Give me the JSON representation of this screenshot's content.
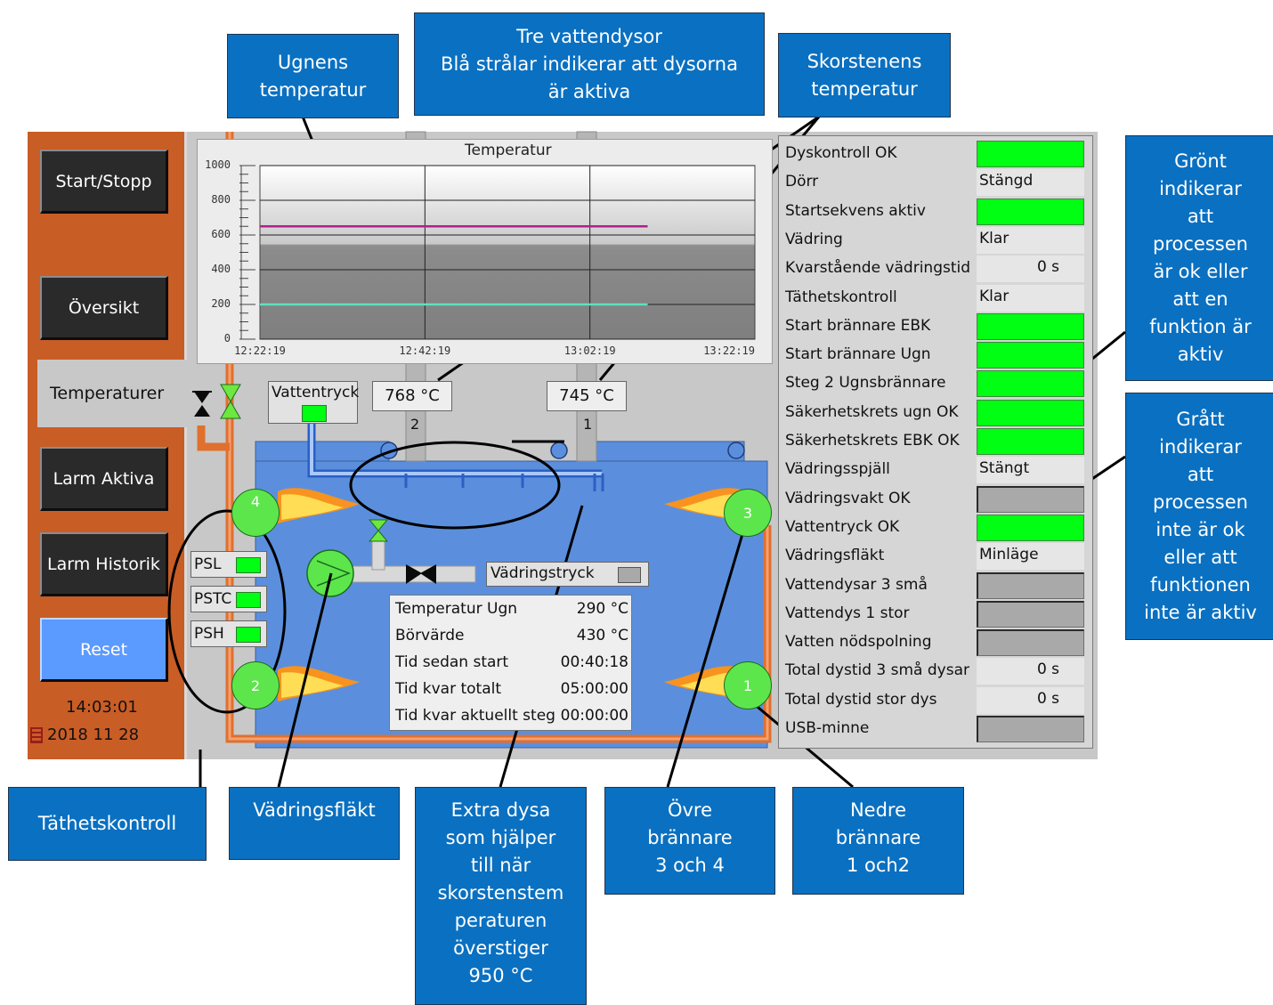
{
  "callouts": {
    "ugnens_temp": "Ugnens\ntemperatur",
    "vattendysor": "Tre vattendysor\nBlå strålar indikerar att dysorna\när aktiva",
    "skorsten_temp": "Skorstenens\ntemperatur",
    "gront": "Grönt\nindikerar\natt\nprocessen\när ok eller\natt en\nfunktion är\naktiv",
    "gratt": "Grått\nindikerar\natt\nprocessen\ninte är ok\neller att\nfunktionen\ninte är aktiv",
    "tathetskontroll": "Täthetskontroll",
    "vadringsflakt": "Vädringsfläkt",
    "extra_dysa": "Extra dysa\nsom hjälper\ntill när\nskorstenstem\nperaturen\növerstiger\n950 °C",
    "ovre": "Övre\nbrännare\n3 och 4",
    "nedre": "Nedre\nbrännare\n1 och2"
  },
  "sidebar": {
    "start_stopp": "Start/Stopp",
    "oversikt": "Översikt",
    "temperaturer": "Temperaturer",
    "larm_aktiva": "Larm Aktiva",
    "larm_historik": "Larm Historik",
    "reset": "Reset",
    "time": "14:03:01",
    "date": "2018 11 28"
  },
  "chart_data": {
    "type": "line",
    "title": "Temperatur",
    "x_ticks": [
      "12:22:19",
      "12:42:19",
      "13:02:19",
      "13:22:19"
    ],
    "y_ticks": [
      "1000",
      "800",
      "600",
      "400",
      "200",
      "0"
    ],
    "ylim": [
      0,
      1000
    ],
    "series": [
      {
        "color": "#b0208a",
        "x": [
          "12:22:19",
          "13:09:19"
        ],
        "values": [
          650,
          650
        ]
      },
      {
        "color": "#5fe0c0",
        "x": [
          "12:22:19",
          "13:09:19"
        ],
        "values": [
          200,
          200
        ]
      }
    ]
  },
  "process": {
    "vattentryck_label": "Vattentryck",
    "stack2_temp": "768 °C",
    "stack1_temp": "745 °C",
    "stack2_num": "2",
    "stack1_num": "1",
    "vadringstryck_label": "Vädringstryck",
    "burners": [
      "4",
      "3",
      "2",
      "1"
    ],
    "ps": [
      "PSL",
      "PSTC",
      "PSH"
    ]
  },
  "info": [
    {
      "label": "Temperatur Ugn",
      "value": "290 °C"
    },
    {
      "label": "Börvärde",
      "value": "430 °C"
    },
    {
      "label": "Tid sedan start",
      "value": "00:40:18"
    },
    {
      "label": "Tid kvar totalt",
      "value": "05:00:00"
    },
    {
      "label": "Tid kvar aktuellt steg",
      "value": "00:00:00"
    }
  ],
  "status": [
    {
      "label": "Dyskontroll OK",
      "type": "green"
    },
    {
      "label": "Dörr",
      "type": "text",
      "value": "Stängd"
    },
    {
      "label": "Startsekvens aktiv",
      "type": "green"
    },
    {
      "label": "Vädring",
      "type": "text",
      "value": "Klar"
    },
    {
      "label": "Kvarstående vädringstid",
      "type": "num",
      "value": "0 s"
    },
    {
      "label": "Täthetskontroll",
      "type": "text",
      "value": "Klar"
    },
    {
      "label": "Start brännare EBK",
      "type": "green"
    },
    {
      "label": "Start brännare Ugn",
      "type": "green"
    },
    {
      "label": "Steg 2 Ugnsbrännare",
      "type": "green"
    },
    {
      "label": "Säkerhetskrets ugn OK",
      "type": "green"
    },
    {
      "label": "Säkerhetskrets EBK OK",
      "type": "green"
    },
    {
      "label": "Vädringsspjäll",
      "type": "text",
      "value": "Stängt"
    },
    {
      "label": "Vädringsvakt OK",
      "type": "gray"
    },
    {
      "label": "Vattentryck OK",
      "type": "green"
    },
    {
      "label": "Vädringsfläkt",
      "type": "text",
      "value": "Minläge"
    },
    {
      "label": "Vattendysar 3 små",
      "type": "gray"
    },
    {
      "label": "Vattendys 1 stor",
      "type": "gray"
    },
    {
      "label": "Vatten nödspolning",
      "type": "gray"
    },
    {
      "label": "Total dystid 3 små dysar",
      "type": "num",
      "value": "0 s"
    },
    {
      "label": "Total dystid stor dys",
      "type": "num",
      "value": "0 s"
    },
    {
      "label": "USB-minne",
      "type": "gray"
    }
  ],
  "colors": {
    "panel_bg": "#c8c8c8",
    "sidebar_bg": "#c95d26",
    "furnace": "#5b8fdd",
    "callout": "#0a70c1",
    "indicator_green": "#00ff12",
    "indicator_gray": "#a9a9a9"
  }
}
